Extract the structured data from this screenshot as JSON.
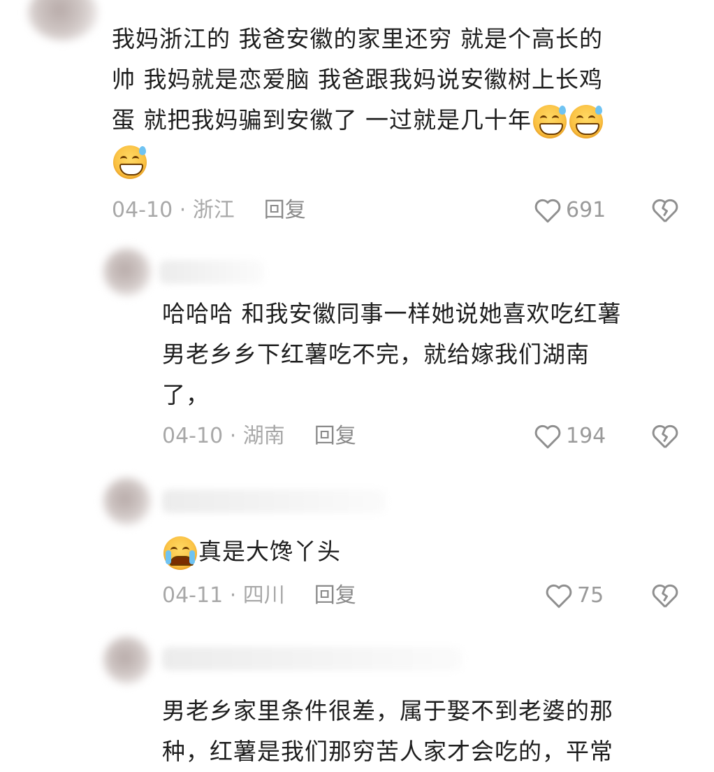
{
  "comments": [
    {
      "lines": [
        "我妈浙江的 我爸安徽的家里还穷  就是个高长的",
        "帅  我妈就是恋爱脑  我爸跟我妈说安徽树上长鸡",
        "蛋 就把我妈骗到安徽了 一过就是几十年"
      ],
      "emoji_icon": "grinning-sweat-emoji",
      "date": "04-10",
      "region": "浙江",
      "reply_label": "回复",
      "likes": "691"
    },
    {
      "lines": [
        "哈哈哈 和我安徽同事一样她说她喜欢吃红薯",
        "男老乡乡下红薯吃不完，就给嫁我们湖南",
        "了，"
      ],
      "date": "04-10",
      "region": "湖南",
      "reply_label": "回复",
      "likes": "194"
    },
    {
      "text": "真是大馋丫头",
      "emoji_icon": "crying-laughing-emoji",
      "date": "04-11",
      "region": "四川",
      "reply_label": "回复",
      "likes": "75"
    },
    {
      "lines": [
        "男老乡家里条件很差，属于娶不到老婆的那",
        "种，红薯是我们那穷苦人家才会吃的，平常"
      ]
    }
  ],
  "separator": " · ",
  "icons": {
    "like": "heart-outline-icon",
    "dislike": "broken-heart-icon"
  }
}
